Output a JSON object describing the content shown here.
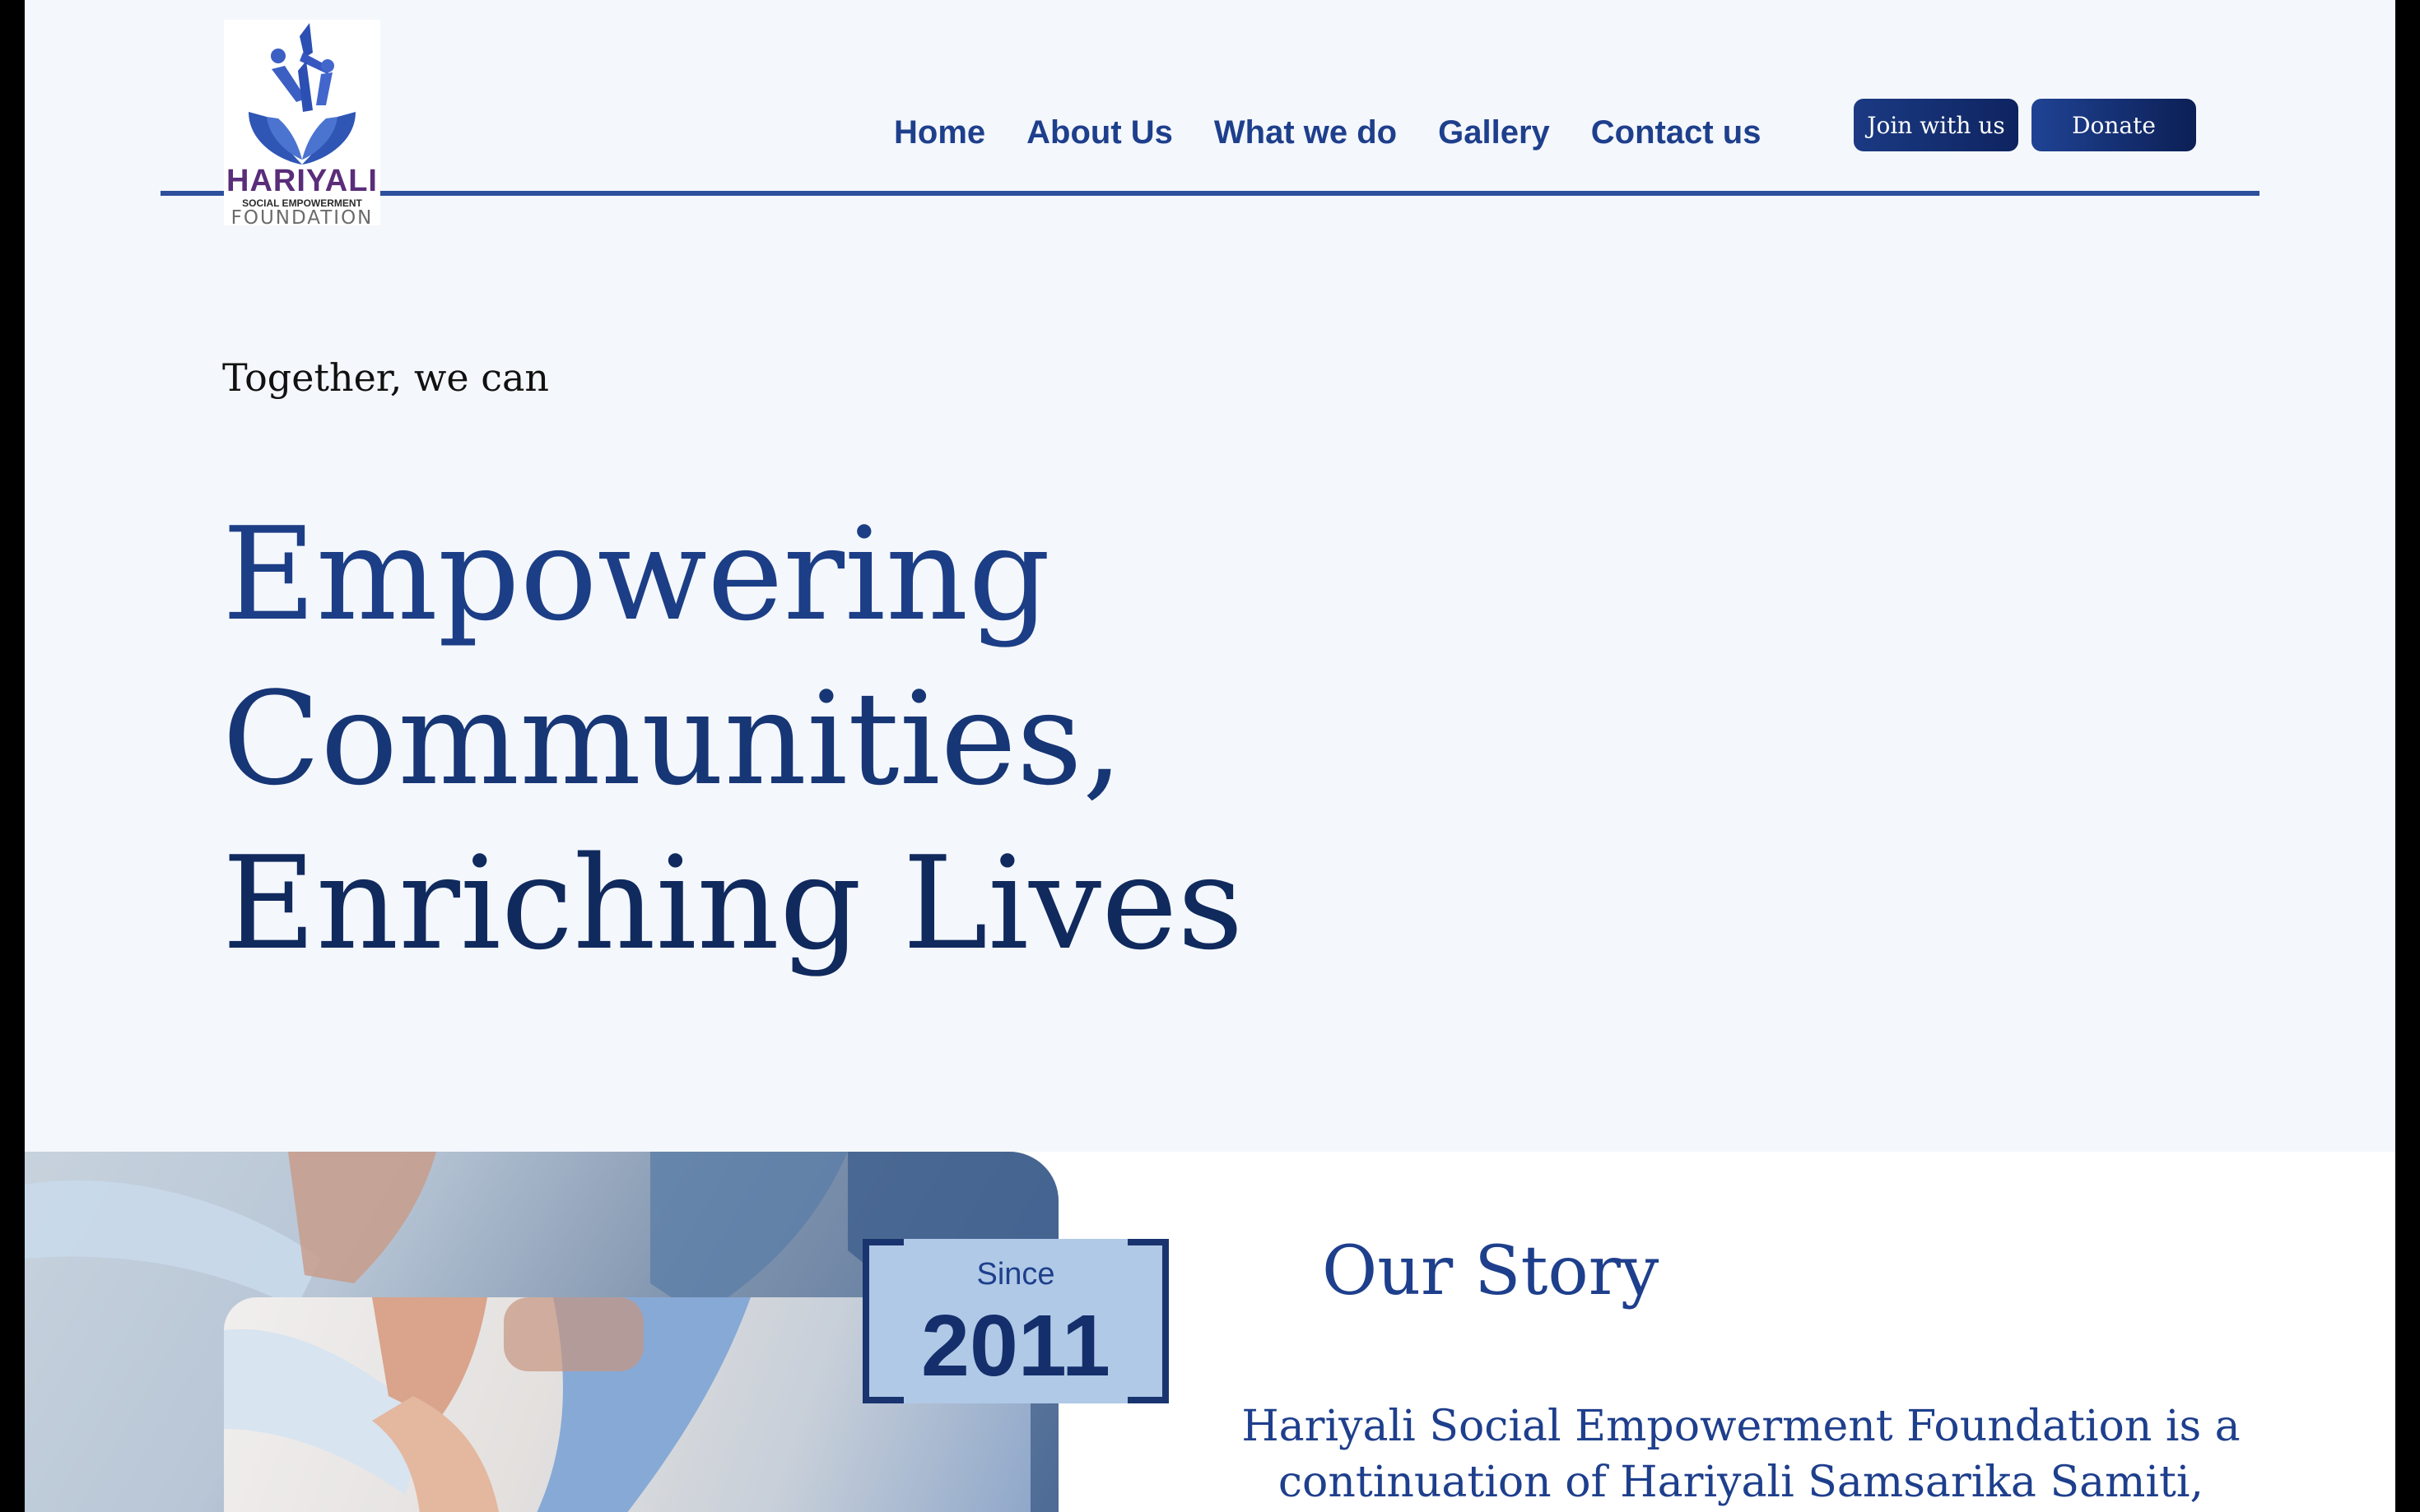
{
  "logo": {
    "name": "HARIYALI",
    "subtitle": "SOCIAL EMPOWERMENT",
    "foundation": "FOUNDATION"
  },
  "nav": {
    "home": "Home",
    "about": "About Us",
    "what_we_do": "What we do",
    "gallery": "Gallery",
    "contact": "Contact us"
  },
  "buttons": {
    "join": "Join with us",
    "donate": "Donate"
  },
  "hero": {
    "tagline": "Together, we can",
    "title_line1": "Empowering",
    "title_line2": "Communities,",
    "title_line3": "Enriching Lives"
  },
  "since": {
    "label": "Since",
    "year": "2011"
  },
  "story": {
    "title": "Our Story",
    "text": "Hariyali Social Empowerment Foundation is a continuation of Hariyali Samsarika Samiti, which"
  },
  "colors": {
    "brand_blue": "#1e3f8c",
    "dark_navy": "#102a5e",
    "page_bg": "#f4f7fc",
    "logo_purple": "#5a2d7a"
  }
}
